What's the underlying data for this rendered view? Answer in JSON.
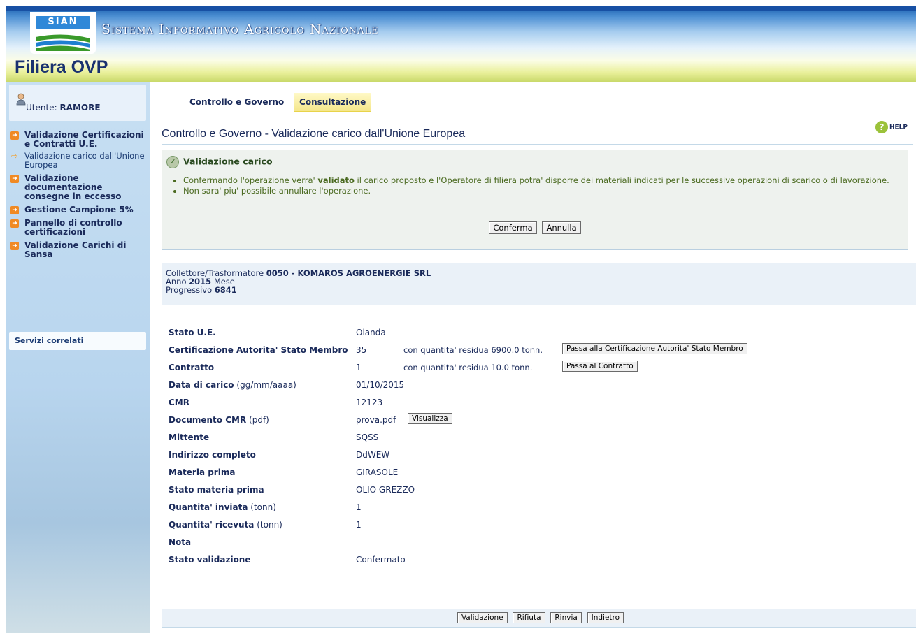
{
  "header": {
    "logo_text": "SIAN",
    "system_name": "Sistema Informativo Agricolo Nazionale",
    "app_name": "Filiera OVP"
  },
  "sidebar": {
    "user_prefix": "Utente:",
    "user_name": "RAMORE",
    "items": [
      {
        "label": "Validazione Certificazioni e Contratti U.E."
      },
      {
        "label": "Validazione carico dall'Unione Europea"
      },
      {
        "label": "Validazione documentazione consegne in eccesso"
      },
      {
        "label": "Gestione Campione 5%"
      },
      {
        "label": "Pannello di controllo certificazioni"
      },
      {
        "label": "Validazione Carichi di Sansa"
      }
    ],
    "related_label": "Servizi correlati"
  },
  "tabs": [
    {
      "label": "Controllo e Governo"
    },
    {
      "label": "Consultazione"
    }
  ],
  "help_label": "HELP",
  "page_title": "Controllo e Governo - Validazione carico dall'Unione Europea",
  "message": {
    "title": "Validazione carico",
    "line1_pre": "Confermando l'operazione verra' ",
    "line1_bold": "validato",
    "line1_post": " il carico proposto e l'Operatore di filiera potra' disporre dei materiali indicati per le successive operazioni di scarico o di lavorazione.",
    "line2": "Non sara' piu' possibile annullare l'operazione.",
    "confirm": "Conferma",
    "cancel": "Annulla"
  },
  "info": {
    "collector_label": "Collettore/Trasformatore",
    "collector_value": "0050 - KOMAROS AGROENERGIE SRL",
    "year_label": "Anno",
    "year_value": "2015",
    "month_label": "Mese",
    "prog_label": "Progressivo",
    "prog_value": "6841"
  },
  "details": {
    "stato_ue_label": "Stato U.E.",
    "stato_ue_value": "Olanda",
    "cert_label": "Certificazione Autorita' Stato Membro",
    "cert_value": "35",
    "cert_extra": "con quantita' residua 6900.0 tonn.",
    "cert_button": "Passa alla Certificazione Autorita' Stato Membro",
    "contratto_label": "Contratto",
    "contratto_value": "1",
    "contratto_extra": "con quantita' residua 10.0 tonn.",
    "contratto_button": "Passa al Contratto",
    "data_label": "Data di carico",
    "data_hint": "(gg/mm/aaaa)",
    "data_value": "01/10/2015",
    "cmr_label": "CMR",
    "cmr_value": "12123",
    "doc_label": "Documento CMR",
    "doc_hint": "(pdf)",
    "doc_value": "prova.pdf",
    "doc_button": "Visualizza",
    "mittente_label": "Mittente",
    "mittente_value": "SQSS",
    "indirizzo_label": "Indirizzo completo",
    "indirizzo_value": "DdWEW",
    "materia_label": "Materia prima",
    "materia_value": "GIRASOLE",
    "stato_materia_label": "Stato materia prima",
    "stato_materia_value": "OLIO GREZZO",
    "q_inviata_label": "Quantita' inviata",
    "q_inviata_hint": "(tonn)",
    "q_inviata_value": "1",
    "q_ricevuta_label": "Quantita' ricevuta",
    "q_ricevuta_hint": "(tonn)",
    "q_ricevuta_value": "1",
    "nota_label": "Nota",
    "stato_val_label": "Stato validazione",
    "stato_val_value": "Confermato"
  },
  "footer": {
    "validazione": "Validazione",
    "rifiuta": "Rifiuta",
    "rinvia": "Rinvia",
    "indietro": "Indietro"
  }
}
